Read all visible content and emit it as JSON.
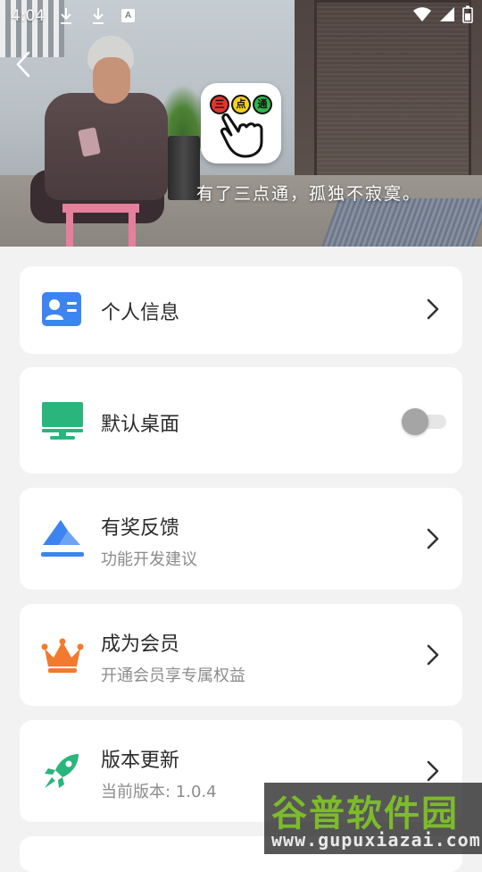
{
  "status_bar": {
    "time": "4:04",
    "download_icons": [
      "download-icon",
      "download-icon"
    ],
    "badge": "A",
    "right_icons": [
      "wifi-icon",
      "cellular-icon",
      "battery-icon"
    ]
  },
  "banner": {
    "slogan": "有了三点通，孤独不寂寞。",
    "logo_dots": [
      "三",
      "点",
      "通"
    ],
    "logo_colors": [
      "#e8322f",
      "#f2d318",
      "#2fb54a"
    ]
  },
  "menu": [
    {
      "id": "profile",
      "title": "个人信息",
      "subtitle": "",
      "icon": "id-card-icon",
      "color": "#3d84f0",
      "control": "chevron"
    },
    {
      "id": "default-desktop",
      "title": "默认桌面",
      "subtitle": "",
      "icon": "monitor-icon",
      "color": "#2ab57d",
      "control": "toggle",
      "toggle_on": false
    },
    {
      "id": "feedback",
      "title": "有奖反馈",
      "subtitle": "功能开发建议",
      "icon": "envelope-icon",
      "color": "#3d84f0",
      "control": "chevron"
    },
    {
      "id": "membership",
      "title": "成为会员",
      "subtitle": "开通会员享专属权益",
      "icon": "crown-icon",
      "color": "#f27a2e",
      "control": "chevron"
    },
    {
      "id": "version",
      "title": "版本更新",
      "subtitle": "当前版本: 1.0.4",
      "icon": "rocket-icon",
      "color": "#2ab57d",
      "control": "chevron"
    }
  ],
  "watermark": {
    "title": "谷普软件园",
    "url": "www.gupuxiazai.com"
  }
}
